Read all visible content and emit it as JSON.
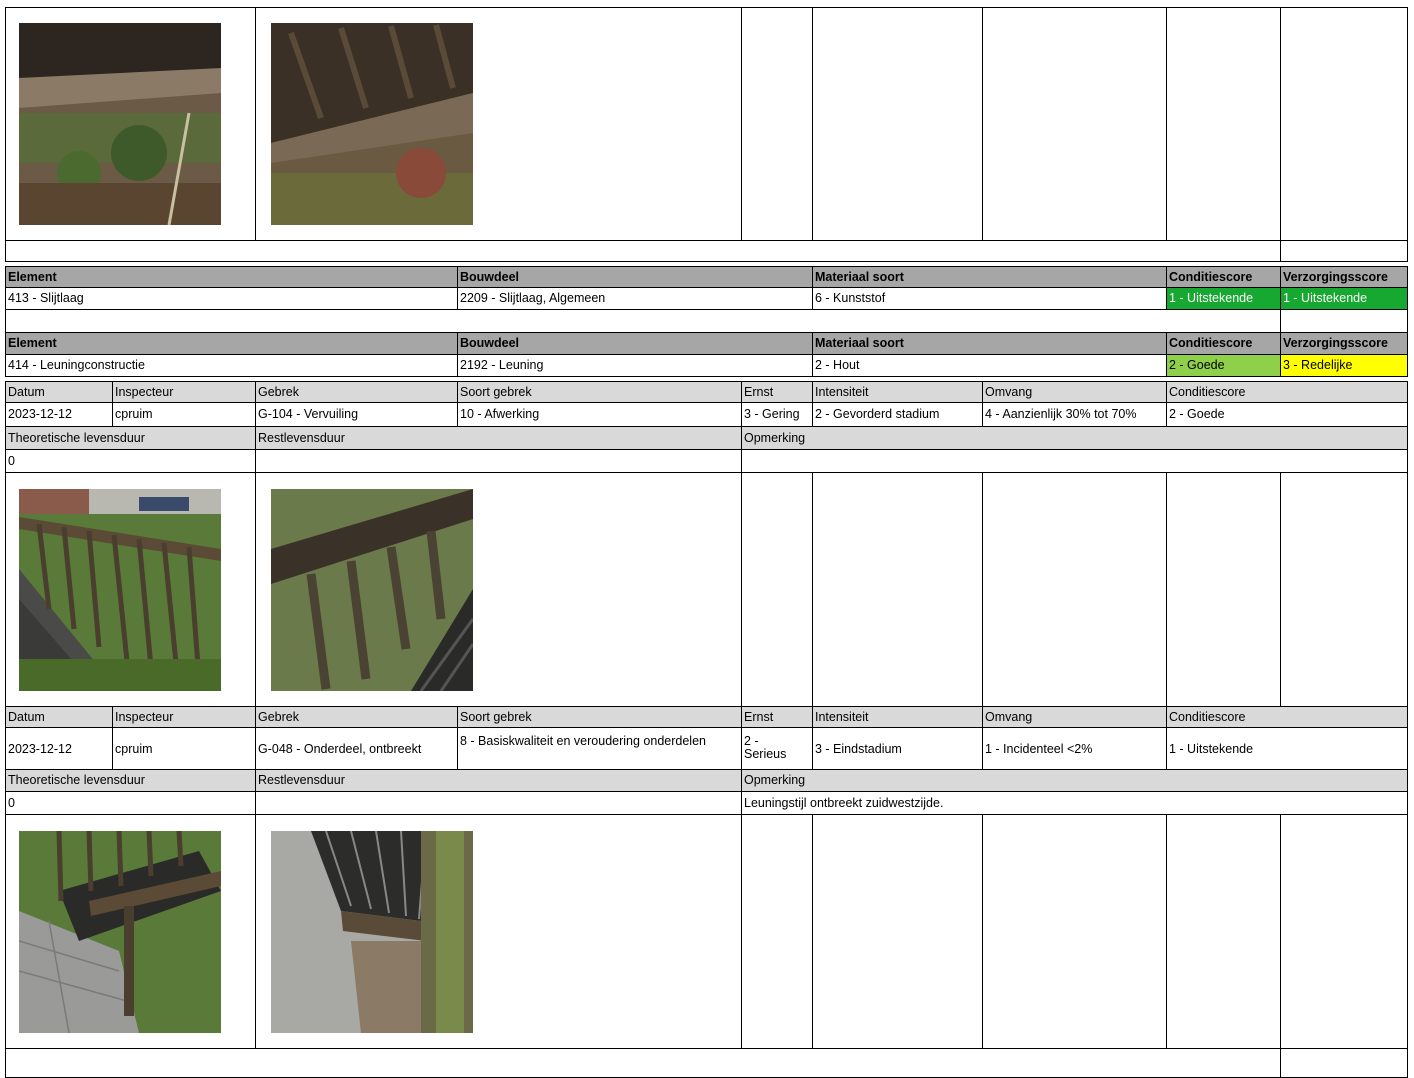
{
  "colors": {
    "header_bg": "#a6a6a6",
    "subheader_bg": "#d9d9d9",
    "score_1_uitstekende": "#16a830",
    "score_2_goede": "#8fd04a",
    "score_3_redelijke": "#ffff00"
  },
  "headers": {
    "element": "Element",
    "bouwdeel": "Bouwdeel",
    "materiaal": "Materiaal soort",
    "conditie": "Conditiescore",
    "verzorging": "Verzorgingsscore"
  },
  "inspection_headers": {
    "datum": "Datum",
    "inspecteur": "Inspecteur",
    "gebrek": "Gebrek",
    "soort": "Soort gebrek",
    "ernst": "Ernst",
    "intensiteit": "Intensiteit",
    "omvang": "Omvang",
    "conditiescore": "Conditiescore",
    "levensduur": "Theoretische levensduur",
    "rest": "Restlevensduur",
    "opmerking": "Opmerking"
  },
  "elements": [
    {
      "element": "413 - Slijtlaag",
      "bouwdeel": "2209 - Slijtlaag, Algemeen",
      "materiaal": "6 - Kunststof",
      "conditie": "1 - Uitstekende",
      "verzorging": "1 - Uitstekende"
    },
    {
      "element": "414 - Leuningconstructie",
      "bouwdeel": "2192 - Leuning",
      "materiaal": "2 - Hout",
      "conditie": "2 - Goede",
      "verzorging": "3 - Redelijke",
      "inspections": [
        {
          "datum": "2023-12-12",
          "inspecteur": "cpruim",
          "gebrek": "G-104 - Vervuiling",
          "soort": "10 - Afwerking",
          "ernst": "3 - Gering",
          "intensiteit": "2 - Gevorderd stadium",
          "omvang": "4 - Aanzienlijk 30% tot 70%",
          "conditiescore": "2 - Goede",
          "levensduur": "0",
          "rest": "",
          "opmerking": ""
        },
        {
          "datum": "2023-12-12",
          "inspecteur": "cpruim",
          "gebrek": "G-048 - Onderdeel, ontbreekt",
          "soort": "8 - Basiskwaliteit en veroudering onderdelen",
          "ernst": "2 - Serieus",
          "intensiteit": "3 - Eindstadium",
          "omvang": "1 - Incidenteel <2%",
          "conditiescore": "1 - Uitstekende",
          "levensduur": "0",
          "rest": "",
          "opmerking": "Leuningstijl ontbreekt zuidwestzijde."
        }
      ]
    }
  ],
  "photos": [
    "bridge-underside-photo",
    "bridge-beams-photo",
    "wooden-railing-photo",
    "railing-closeup-photo",
    "railing-ground-photo",
    "deck-edge-photo"
  ]
}
